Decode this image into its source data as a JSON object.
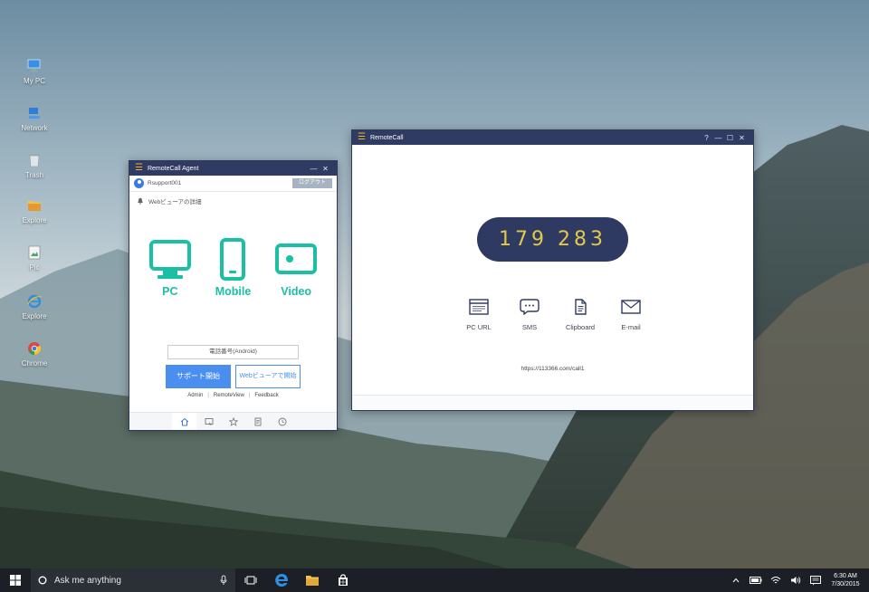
{
  "desktop": {
    "icons": [
      {
        "label": "My PC",
        "icon": "monitor-icon"
      },
      {
        "label": "Network",
        "icon": "network-icon"
      },
      {
        "label": "Trash",
        "icon": "recycle-bin-icon"
      },
      {
        "label": "Explore",
        "icon": "folder-icon"
      },
      {
        "label": "Pic",
        "icon": "picture-icon"
      },
      {
        "label": "Explore",
        "icon": "internet-explorer-icon"
      },
      {
        "label": "Chrome",
        "icon": "chrome-icon"
      }
    ]
  },
  "agent": {
    "title": "RemoteCall Agent",
    "user": "Rsupport001",
    "logout_label": "ログアウト",
    "web_viewer_detail": "Webビューアの詳細",
    "modes": [
      {
        "label": "PC",
        "icon": "monitor-icon"
      },
      {
        "label": "Mobile",
        "icon": "smartphone-icon"
      },
      {
        "label": "Video",
        "icon": "video-icon"
      }
    ],
    "phone_placeholder": "電話番号(Android)",
    "start_label": "サポート開始",
    "web_start_label": "Webビューアで開始",
    "links": [
      "Admin",
      "RemoteView",
      "Feedback"
    ],
    "toolbar": [
      "home-icon",
      "remote-cursor-icon",
      "star-icon",
      "notes-icon",
      "clock-icon"
    ],
    "accent_color": "#1bbfa4",
    "button_color": "#4a8ef0"
  },
  "remotecall": {
    "title": "RemoteCall",
    "title_controls": [
      "?",
      "—",
      "☐",
      "✕"
    ],
    "code": "179 283",
    "share": [
      {
        "label": "PC URL",
        "icon": "browser-window-icon"
      },
      {
        "label": "SMS",
        "icon": "chat-bubble-icon"
      },
      {
        "label": "Clipboard",
        "icon": "clipboard-icon"
      },
      {
        "label": "E-mail",
        "icon": "envelope-icon"
      }
    ],
    "url": "https://113366.com/call1",
    "code_bg": "#2f3a62",
    "code_color": "#e3c84a"
  },
  "taskbar": {
    "search_placeholder": "Ask me anything",
    "time": "6:30 AM",
    "date": "7/30/2015"
  }
}
